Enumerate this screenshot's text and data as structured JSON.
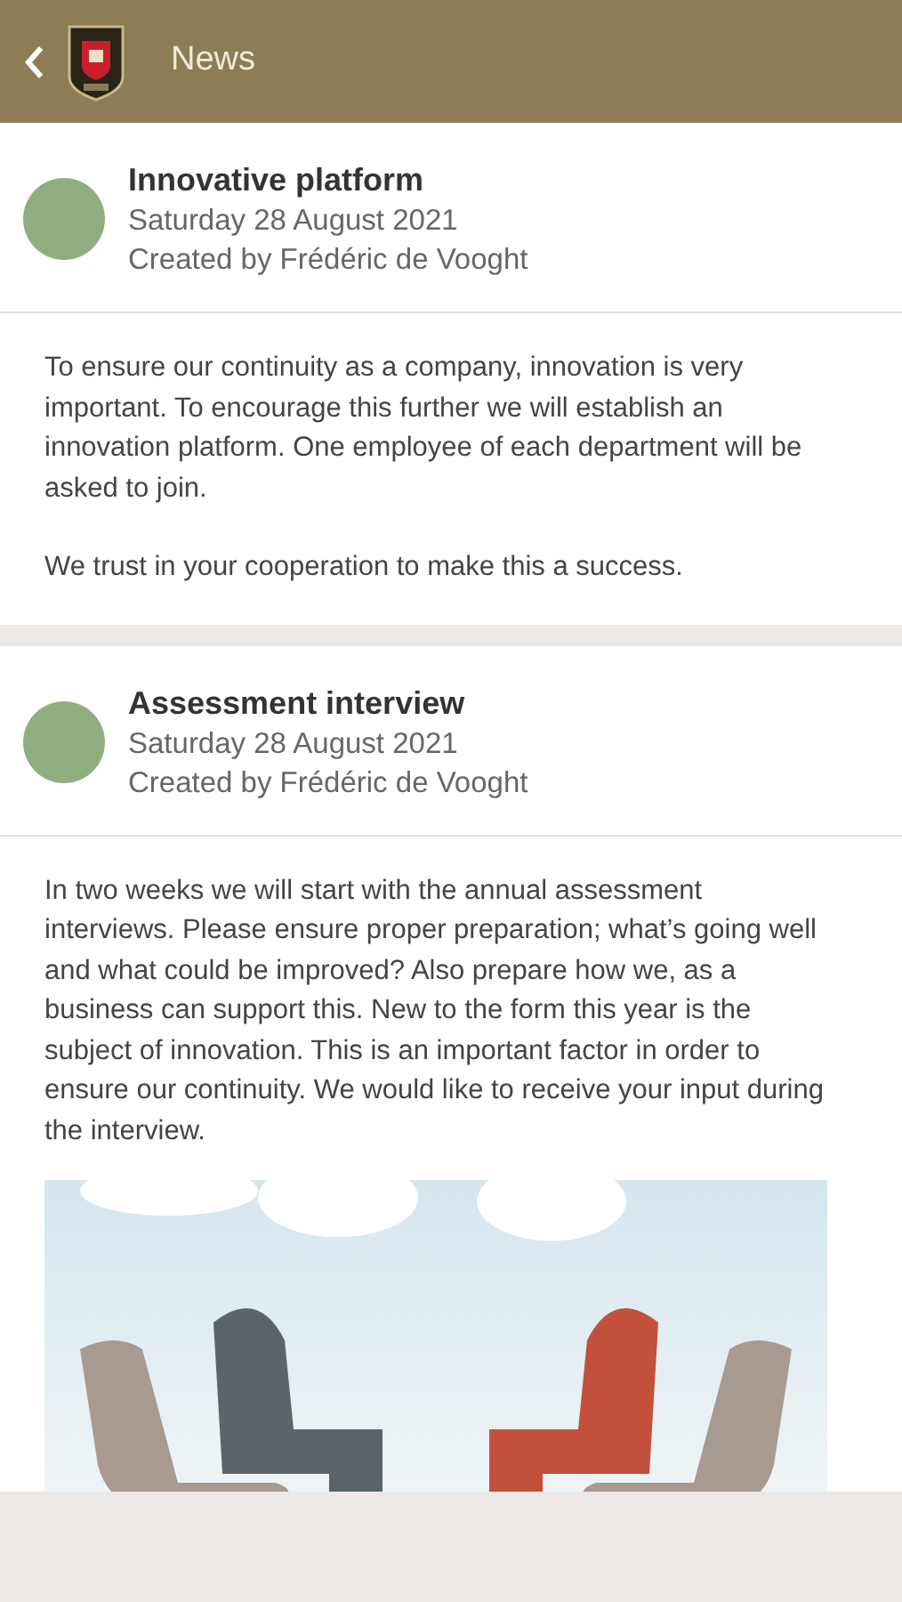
{
  "header": {
    "title": "News"
  },
  "posts": [
    {
      "title": "Innovative platform",
      "date": "Saturday 28 August 2021",
      "author": "Created by Frédéric de Vooght",
      "blocks": [
        {
          "kind": "paragraph",
          "text": "To ensure our continuity as a company, innovation is very important. To encourage this further we will establish an innovation platform. One employee of each department will be asked to join."
        },
        {
          "kind": "paragraph",
          "text": "We trust in your cooperation to make this a success."
        }
      ]
    },
    {
      "title": "Assessment interview",
      "date": "Saturday 28 August 2021",
      "author": "Created by Frédéric de Vooght",
      "blocks": [
        {
          "kind": "paragraph",
          "text": "In two weeks we will start with the annual assessment interviews. Please ensure proper preparation; what’s going well and what could be improved? Also prepare how we, as a business can support this. New to the form this year is the subject of innovation. This is an important factor in order to ensure our continuity. We would like to receive your input during the interview."
        },
        {
          "kind": "image"
        }
      ]
    }
  ]
}
